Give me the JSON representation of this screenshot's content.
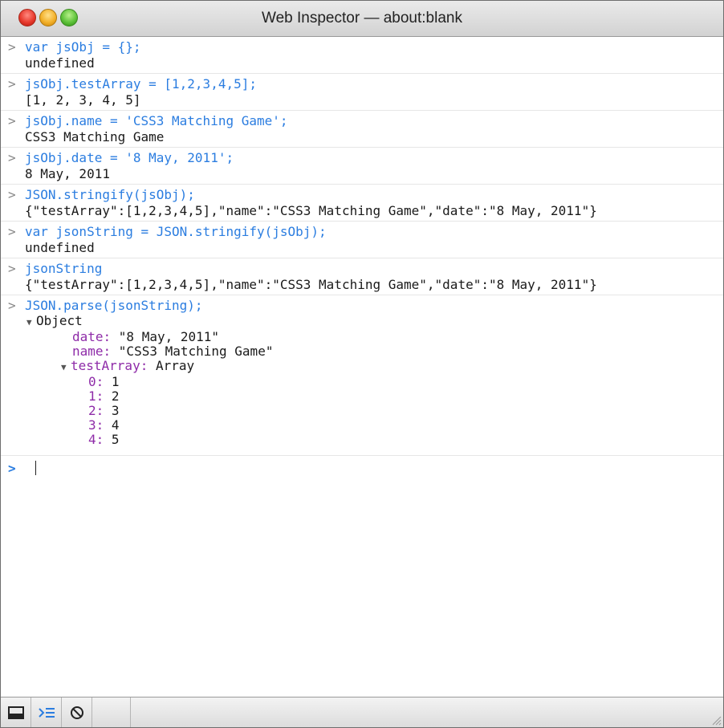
{
  "window": {
    "title": "Web Inspector — about:blank"
  },
  "console": {
    "entries": [
      {
        "command": "var jsObj = {};",
        "result": "undefined"
      },
      {
        "command": "jsObj.testArray = [1,2,3,4,5];",
        "result": "[1, 2, 3, 4, 5]"
      },
      {
        "command": "jsObj.name = 'CSS3 Matching Game';",
        "result": "CSS3 Matching Game"
      },
      {
        "command": "jsObj.date = '8 May, 2011';",
        "result": "8 May, 2011"
      },
      {
        "command": "JSON.stringify(jsObj);",
        "result": "{\"testArray\":[1,2,3,4,5],\"name\":\"CSS3 Matching Game\",\"date\":\"8 May, 2011\"}"
      },
      {
        "command": "var jsonString = JSON.stringify(jsObj);",
        "result": "undefined"
      },
      {
        "command": "jsonString",
        "result": "{\"testArray\":[1,2,3,4,5],\"name\":\"CSS3 Matching Game\",\"date\":\"8 May, 2011\"}"
      },
      {
        "command": "JSON.parse(jsonString);"
      }
    ],
    "object_tree": {
      "root_label": "Object",
      "date_key": "date",
      "date_value": "\"8 May, 2011\"",
      "name_key": "name",
      "name_value": "\"CSS3 Matching Game\"",
      "array_key": "testArray",
      "array_type": "Array",
      "items": [
        {
          "index": "0",
          "value": "1"
        },
        {
          "index": "1",
          "value": "2"
        },
        {
          "index": "2",
          "value": "3"
        },
        {
          "index": "3",
          "value": "4"
        },
        {
          "index": "4",
          "value": "5"
        }
      ]
    },
    "prompt_symbol": ">",
    "input_value": ""
  },
  "toolbar": {
    "icons": [
      "dock-window-icon",
      "console-icon",
      "clear-console-icon"
    ]
  },
  "colors": {
    "command": "#2b7de0",
    "property_key": "#8e2ba8",
    "result": "#1a1a1a"
  }
}
